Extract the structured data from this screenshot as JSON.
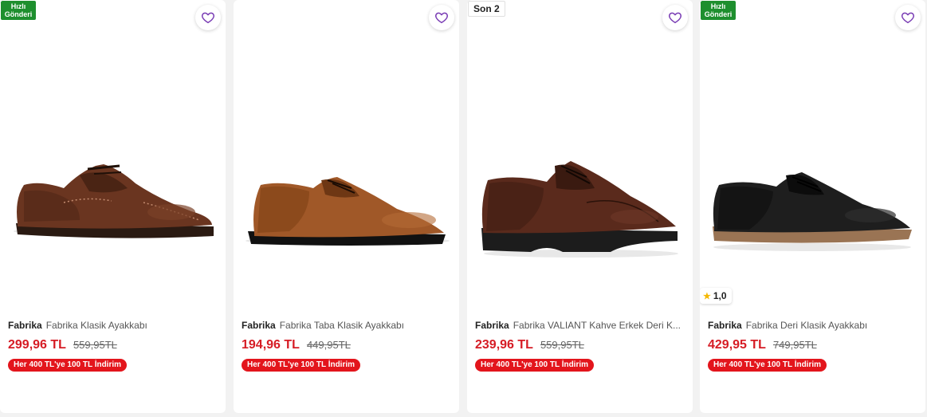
{
  "products": [
    {
      "badge_fast": [
        "Hızlı",
        "Gönderi"
      ],
      "brand": "Fabrika",
      "name": "Fabrika Klasik Ayakkabı",
      "price": "299,96 TL",
      "old_price": "559,95TL",
      "promo": "Her 400 TL'ye 100 TL İndirim"
    },
    {
      "brand": "Fabrika",
      "name": "Fabrika Taba Klasik Ayakkabı",
      "price": "194,96 TL",
      "old_price": "449,95TL",
      "promo": "Her 400 TL'ye 100 TL İndirim"
    },
    {
      "stock_badge": "Son 2",
      "brand": "Fabrika",
      "name": "Fabrika VALIANT Kahve Erkek Deri K...",
      "price": "239,96 TL",
      "old_price": "559,95TL",
      "promo": "Her 400 TL'ye 100 TL İndirim"
    },
    {
      "badge_fast": [
        "Hızlı",
        "Gönderi"
      ],
      "rating": "1,0",
      "brand": "Fabrika",
      "name": "Fabrika Deri Klasik Ayakkabı",
      "price": "429,95 TL",
      "old_price": "749,95TL",
      "promo": "Her 400 TL'ye 100 TL İndirim"
    }
  ],
  "icons": {
    "favorite": "heart-outline-icon",
    "rating": "star-icon"
  },
  "colors": {
    "price": "#d61c25",
    "promo_bg": "#e3151c",
    "fast_badge_bg": "#1e8f2e",
    "favorite_icon": "#7b3fb5",
    "rating_star": "#f5b800"
  }
}
